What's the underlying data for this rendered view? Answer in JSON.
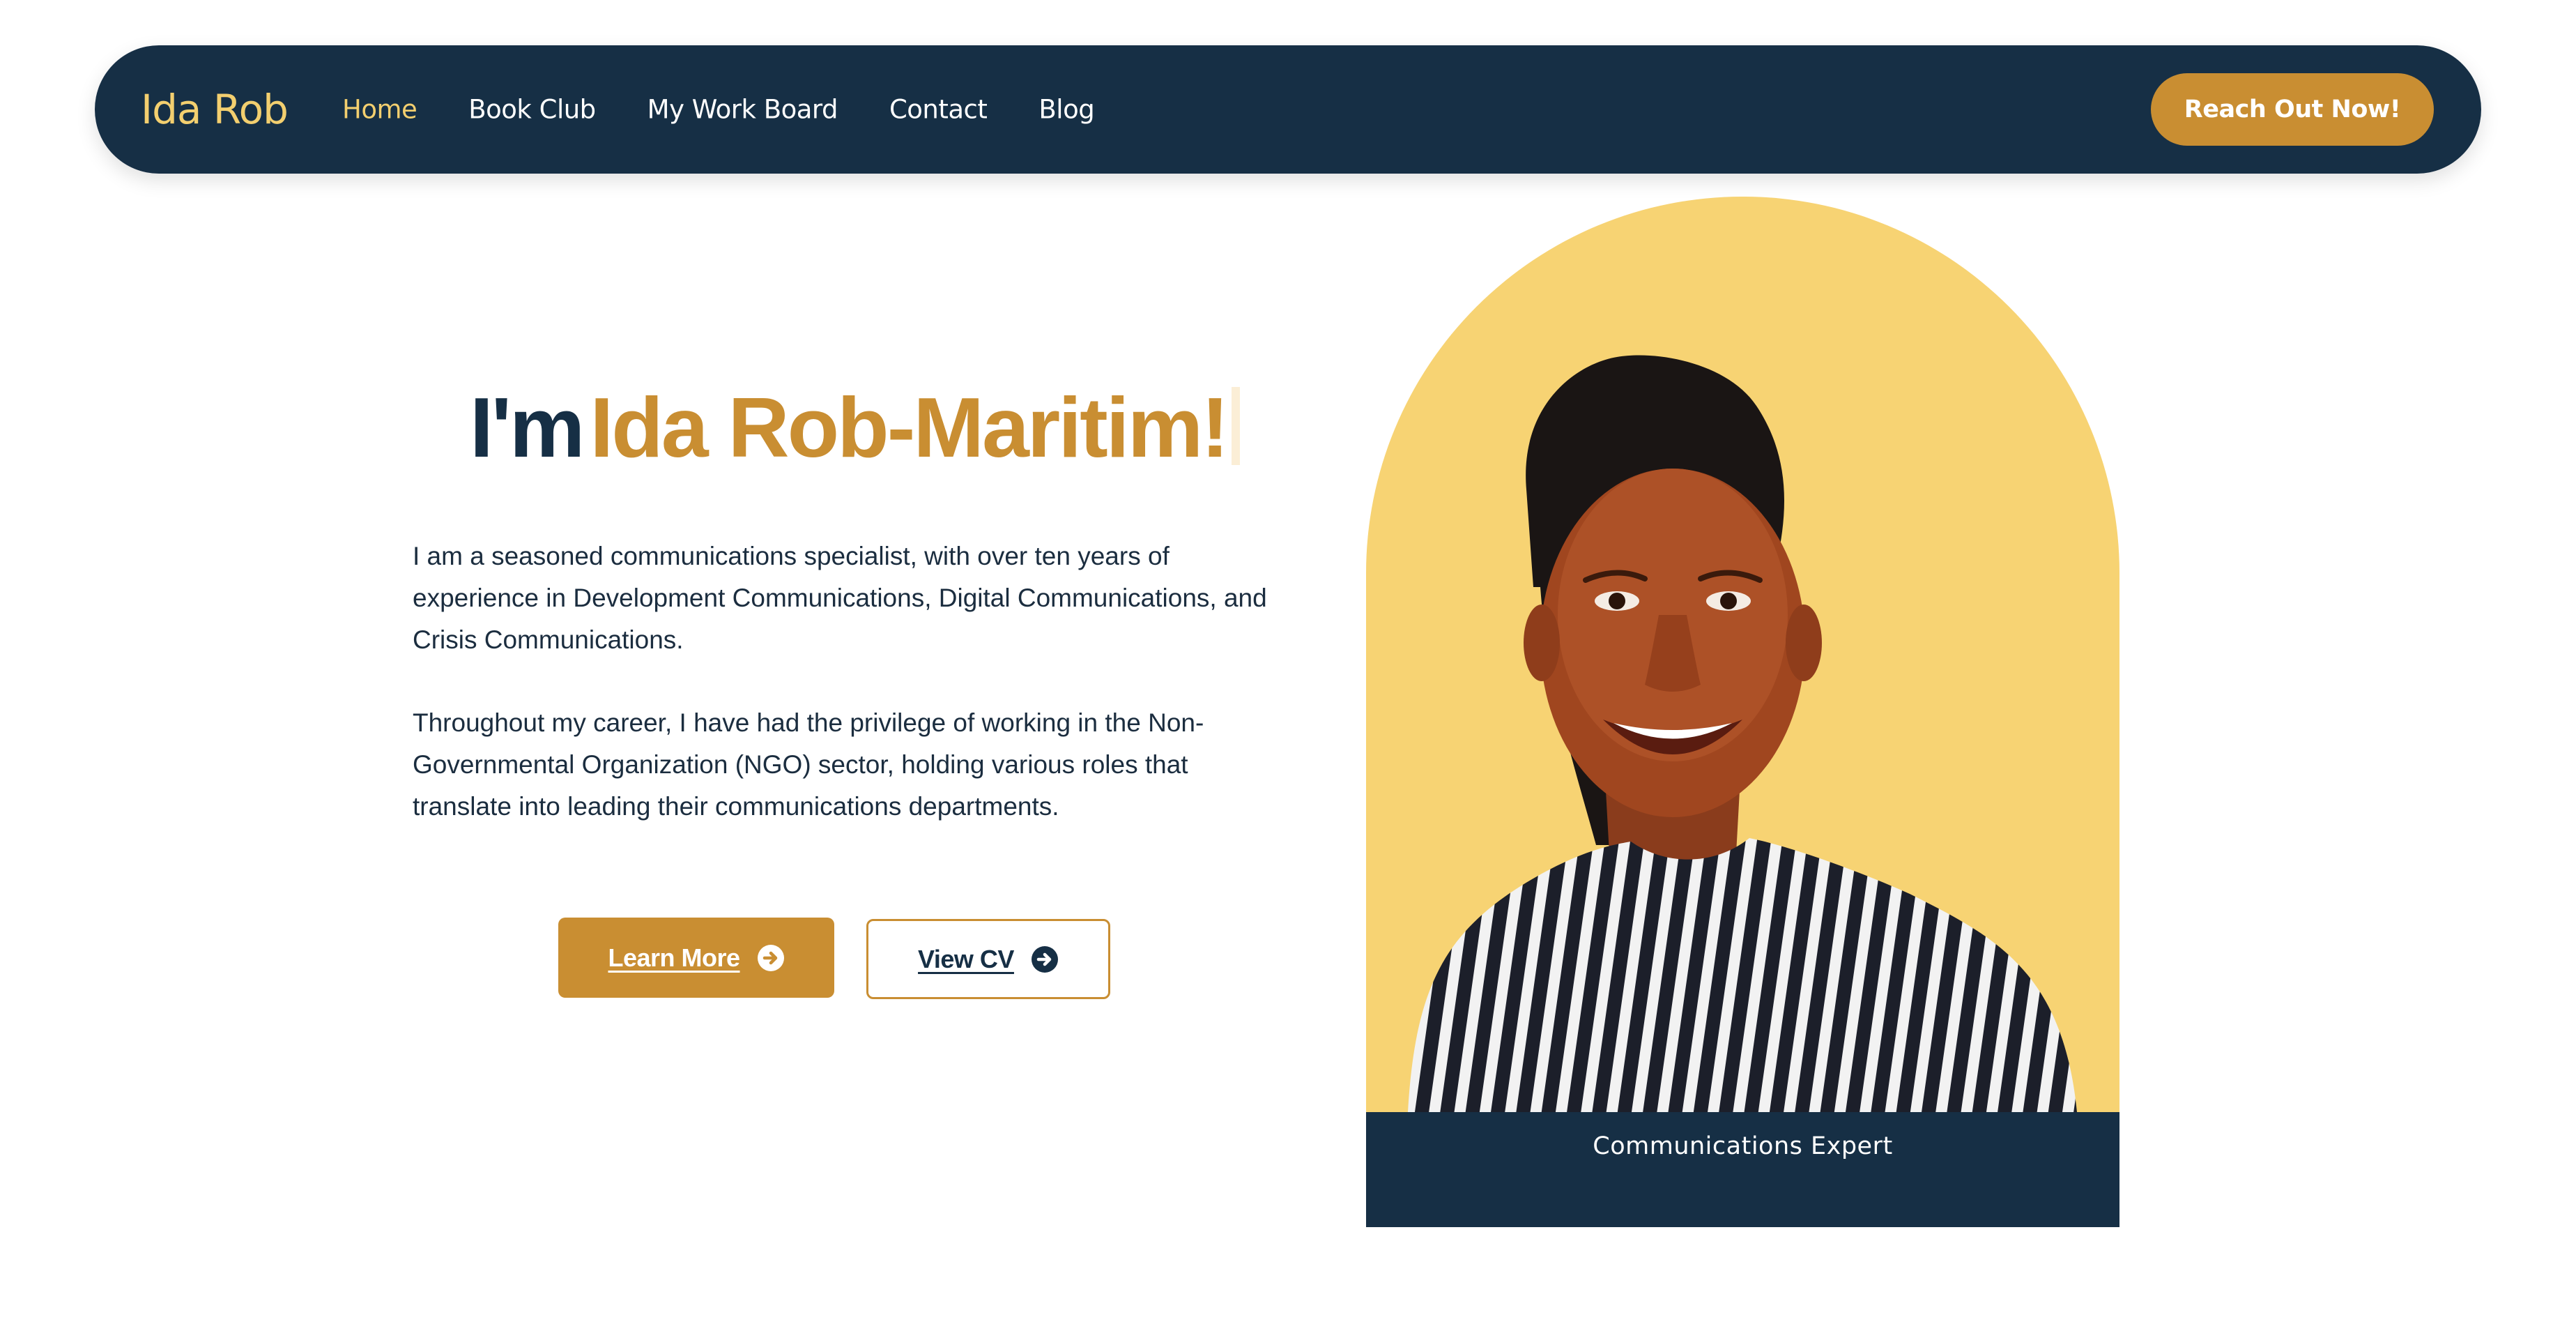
{
  "nav": {
    "brand": "Ida Rob",
    "links": [
      "Home",
      "Book Club",
      "My Work Board",
      "Contact",
      "Blog"
    ],
    "active": "Home",
    "cta": "Reach Out Now!"
  },
  "hero": {
    "title_prefix": "I'm",
    "title_name": "Ida Rob-Maritim!",
    "paragraph_1": "I am a seasoned communications specialist, with over ten years of experience in Development Communications, Digital Communications, and Crisis Communications.",
    "paragraph_2": "Throughout my career, I have had the privilege of working in the Non-Governmental Organization (NGO) sector, holding various roles that translate into leading their communications departments.",
    "learn_more": "Learn More",
    "view_cv": "View CV"
  },
  "portrait": {
    "caption": "Communications Expert"
  },
  "colors": {
    "navy": "#162f45",
    "gold": "#c98e32",
    "yellow": "#f7d373",
    "brand_yellow": "#f3cf6f"
  },
  "icons": {
    "button_arrow": "arrow-circle-right-icon"
  }
}
